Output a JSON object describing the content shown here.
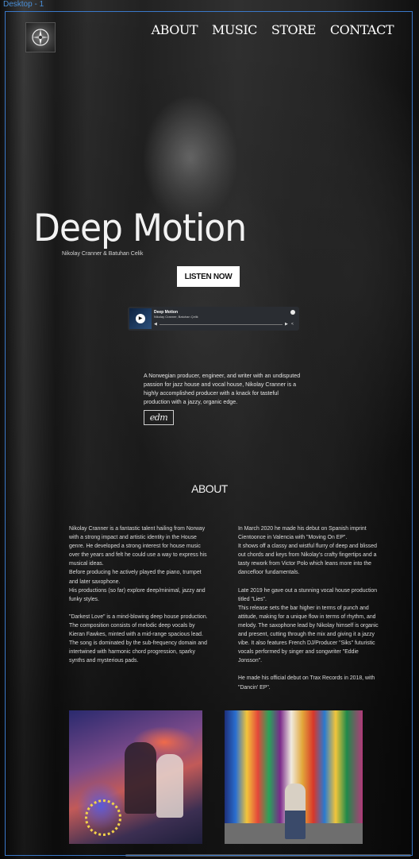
{
  "frame_label": "Desktop - 1",
  "logo": {
    "icon": "compass-badge-icon"
  },
  "nav": [
    "ABOUT",
    "MUSIC",
    "STORE",
    "CONTACT"
  ],
  "hero": {
    "title": "Deep Motion",
    "subtitle": "Nikolay Cranner & Batuhan Celik",
    "cta": "LISTEN NOW"
  },
  "player": {
    "track_title": "Deep Motion",
    "artists": "Nikolay Cranner, Batuhan Çelik",
    "icons": [
      "play-icon",
      "spotify-icon",
      "skip-back-icon",
      "skip-forward-icon",
      "share-icon"
    ]
  },
  "bio": "A Norwegian producer, engineer, and writer with an undisputed passion for jazz house and vocal house, Nikolay Cranner is a highly accomplished producer with a knack for tasteful production with a jazzy, organic edge.",
  "edm_badge": "edm",
  "about": {
    "heading": "ABOUT",
    "left": [
      "Nikolay Cranner is a fantastic talent hailing from Norway with a strong impact and artistic identity in the House genre. He developed a strong interest for house music over the years and felt he could use a way to express his musical ideas.",
      "Before producing he actively played the piano, trumpet and later saxophone.",
      "His productions (so far) explore deep/minimal, jazzy and funky styles.",
      "",
      "\"Darkest Love\" is a mind-blowing deep house production. The composition consists of melodic deep vocals by Kieran Fawkes, minted with a mid-range spacious lead. The song is dominated by the sub-frequency domain and intertwined with harmonic chord progression, sparky synths and mysterious pads."
    ],
    "right": [
      "In March 2020 he made his debut on Spanish imprint Cientoonce in Valencia with \"Moving On EP\".",
      "It shows off a classy and wistful flurry of deep and blissed out chords and keys from Nikolay's crafty fingertips and a tasty rework from Victor Polo which leans more into the dancefloor fundamentals.",
      "",
      "Late 2019 he gave out a stunning vocal house production titled \"Lies\".",
      "This release sets the bar higher in terms of punch and attitude, making for a unique flow in terms of rhythm, and melody. The saxophone lead by Nikolay himself is organic and present, cutting through the mix and giving it a jazzy vibe. It also features French DJ/Producer \"Siks\" futuristic vocals performed by singer and songwriter \"Eddie Jonsson\".",
      "",
      "He made his official debut on Trax Records in 2018, with \"Dancin' EP\"."
    ]
  }
}
